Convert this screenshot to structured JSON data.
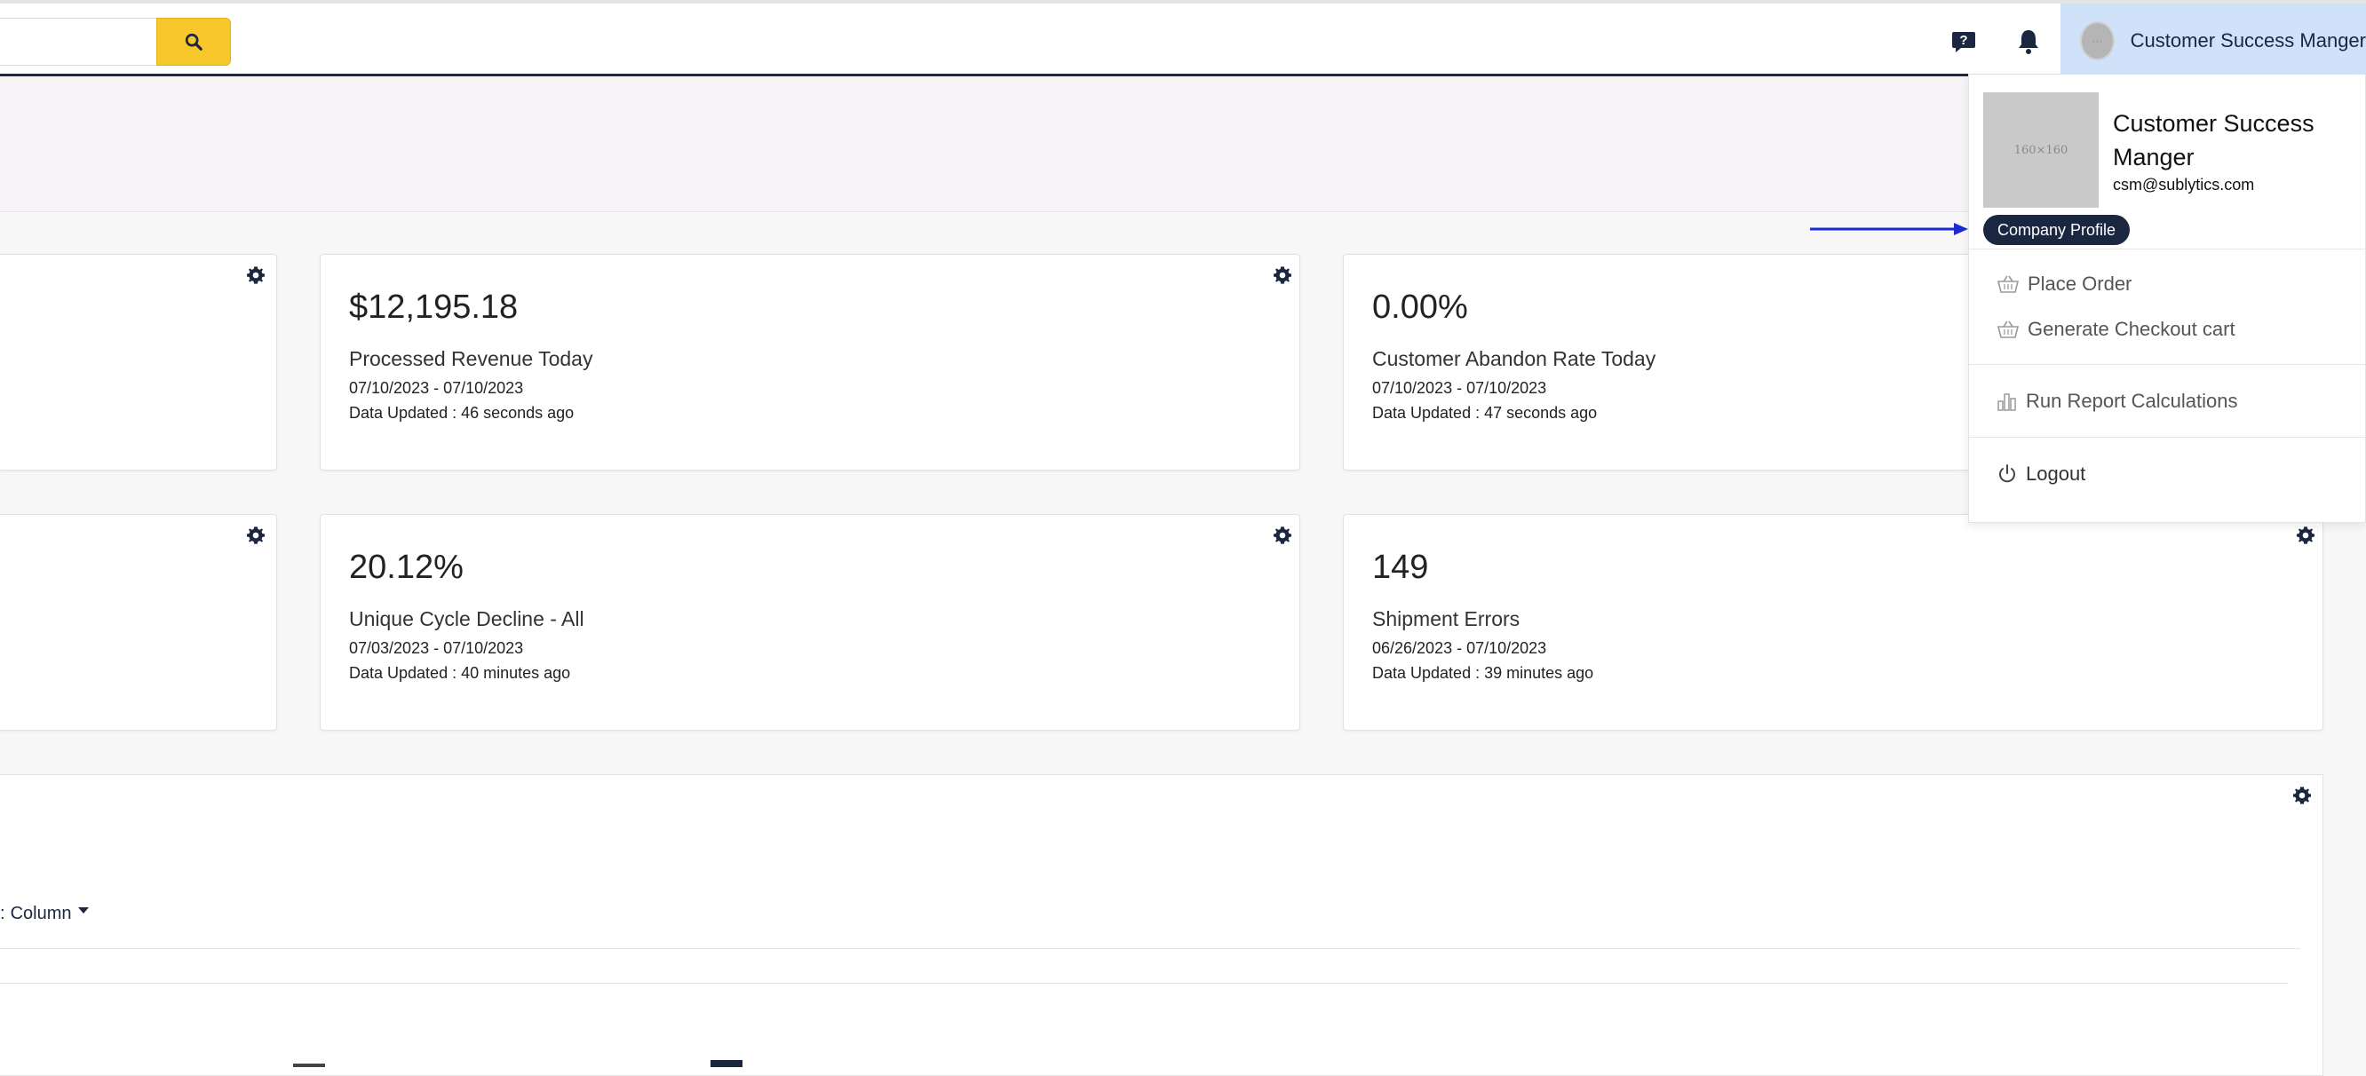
{
  "header": {
    "search": {
      "placeholder": "",
      "value": ""
    },
    "user_name": "Customer Success Manger"
  },
  "dropdown": {
    "avatar_text": "160×160",
    "name": "Customer Success Manger",
    "email": "csm@sublytics.com",
    "company_profile": "Company Profile",
    "items": [
      {
        "label": "Place Order",
        "icon": "basket-icon"
      },
      {
        "label": "Generate Checkout cart",
        "icon": "basket-icon"
      },
      {
        "label": "Run Report Calculations",
        "icon": "bar-chart-icon"
      },
      {
        "label": "Logout",
        "icon": "power-icon"
      }
    ]
  },
  "cards": [
    {
      "value": "$12,195.18",
      "label": "Processed Revenue Today",
      "range": "07/10/2023 - 07/10/2023",
      "updated": "Data Updated : 46 seconds ago"
    },
    {
      "value": "0.00%",
      "label": "Customer Abandon Rate Today",
      "range": "07/10/2023 - 07/10/2023",
      "updated": "Data Updated : 47 seconds ago"
    },
    {
      "value": "20.12%",
      "label": "Unique Cycle Decline - All",
      "range": "07/03/2023 - 07/10/2023",
      "updated": "Data Updated : 40 minutes ago"
    },
    {
      "value": "149",
      "label": "Shipment Errors",
      "range": "06/26/2023 - 07/10/2023",
      "updated": "Data Updated : 39 minutes ago"
    }
  ],
  "panel": {
    "column_label": "Column"
  },
  "colors": {
    "navy": "#1b2740",
    "accent_yellow": "#f8c72b",
    "user_menu_bg": "#cfe2fa",
    "arrow": "#1a2bd6"
  }
}
